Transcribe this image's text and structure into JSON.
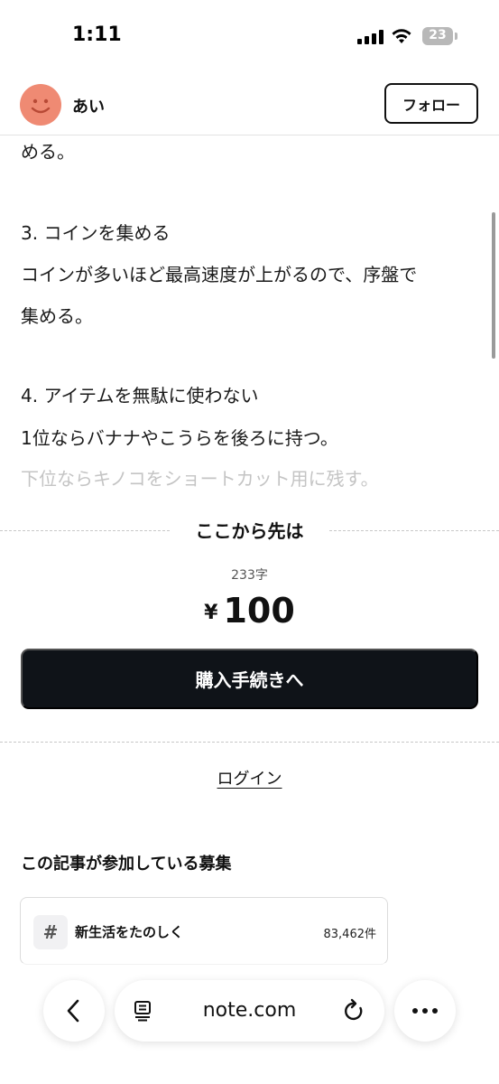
{
  "status_bar": {
    "time": "1:11",
    "battery": "23"
  },
  "header": {
    "author_name": "あい",
    "follow_label": "フォロー",
    "avatar_color": "#ef8a73"
  },
  "article": {
    "lines": [
      "める。",
      "3. コインを集める",
      "コインが多いほど最高速度が上がるので、序盤で",
      "集める。",
      "4. アイテムを無駄に使わない",
      "1位ならバナナやこうらを後ろに持つ。",
      "下位ならキノコをショートカット用に残す。"
    ]
  },
  "paywall": {
    "title": "ここから先は",
    "char_count": "233字",
    "currency": "¥",
    "price": "100",
    "purchase_label": "購入手続きへ",
    "login_label": "ログイン"
  },
  "contests": {
    "section_title": "この記事が参加している募集",
    "items": [
      {
        "hash": "#",
        "name": "新生活をたのしく",
        "count": "83,462件"
      }
    ]
  },
  "browser": {
    "url": "note.com",
    "icons": [
      "back-icon",
      "reader-icon",
      "reload-icon",
      "more-icon"
    ]
  }
}
